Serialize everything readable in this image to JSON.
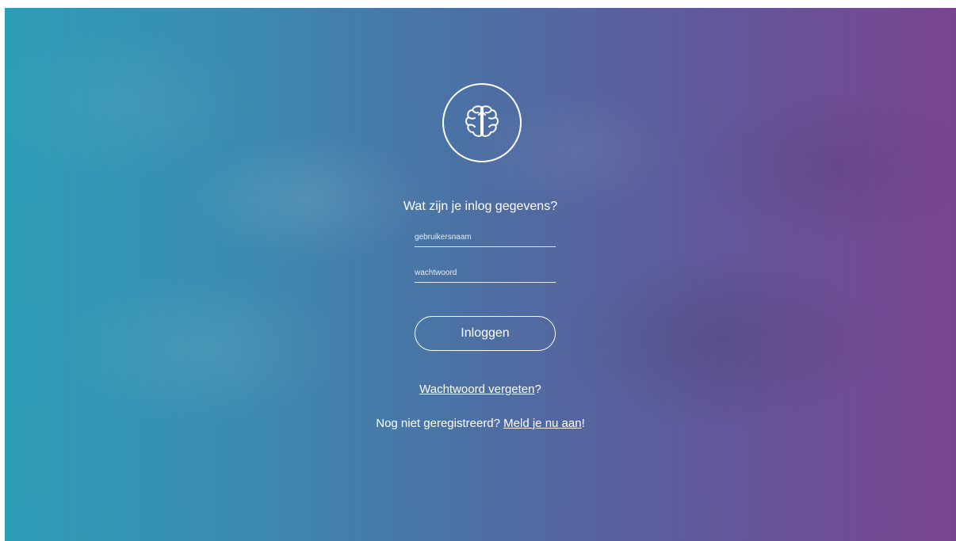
{
  "login": {
    "heading": "Wat zijn je inlog gegevens?",
    "username_placeholder": "gebruikersnaam",
    "password_placeholder": "wachtwoord",
    "login_button": "Inloggen",
    "forgot_link_text": "Wachtwoord vergeten",
    "forgot_suffix": "?",
    "register_prefix": "Nog niet geregistreerd? ",
    "register_link_text": "Meld je nu aan",
    "register_suffix": "!"
  },
  "icons": {
    "logo": "brain-icon"
  },
  "colors": {
    "gradient_left": "#2e9db6",
    "gradient_right": "#7a4590",
    "text": "#ffffff"
  }
}
